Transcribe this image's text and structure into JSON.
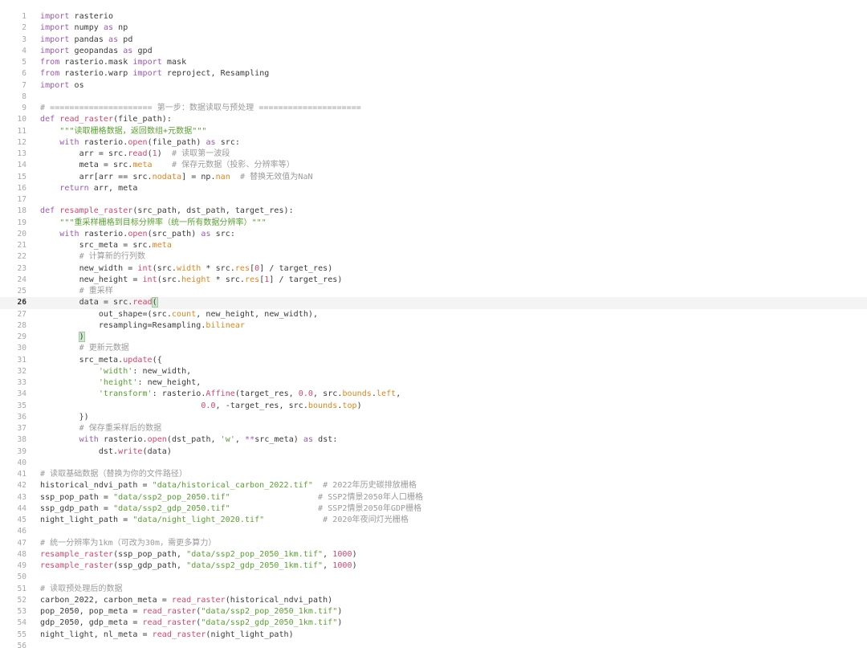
{
  "colors": {
    "keyword": "#9b58b5",
    "function": "#d2466e",
    "string": "#58a130",
    "comment": "#9a9a9a",
    "number": "#d2466e",
    "attribute": "#e0841a",
    "line_number": "#a6a6a6",
    "active_line_bg": "#f4f4f4"
  },
  "editor": {
    "active_line": 26,
    "lines": [
      {
        "n": "1",
        "t": [
          [
            "import",
            "kw"
          ],
          [
            " rasterio",
            ""
          ]
        ]
      },
      {
        "n": "2",
        "t": [
          [
            "import",
            "kw"
          ],
          [
            " numpy ",
            ""
          ],
          [
            "as",
            "kw"
          ],
          [
            " np",
            ""
          ]
        ]
      },
      {
        "n": "3",
        "t": [
          [
            "import",
            "kw"
          ],
          [
            " pandas ",
            ""
          ],
          [
            "as",
            "kw"
          ],
          [
            " pd",
            ""
          ]
        ]
      },
      {
        "n": "4",
        "t": [
          [
            "import",
            "kw"
          ],
          [
            " geopandas ",
            ""
          ],
          [
            "as",
            "kw"
          ],
          [
            " gpd",
            ""
          ]
        ]
      },
      {
        "n": "5",
        "t": [
          [
            "from",
            "kw"
          ],
          [
            " rasterio.mask ",
            ""
          ],
          [
            "import",
            "kw"
          ],
          [
            " mask",
            ""
          ]
        ]
      },
      {
        "n": "6",
        "t": [
          [
            "from",
            "kw"
          ],
          [
            " rasterio.warp ",
            ""
          ],
          [
            "import",
            "kw"
          ],
          [
            " reproject, Resampling",
            ""
          ]
        ]
      },
      {
        "n": "7",
        "t": [
          [
            "import",
            "kw"
          ],
          [
            " os",
            ""
          ]
        ]
      },
      {
        "n": "8",
        "t": []
      },
      {
        "n": "9",
        "t": [
          [
            "# ===================== 第一步：数据读取与预处理 =====================",
            "com"
          ]
        ]
      },
      {
        "n": "10",
        "t": [
          [
            "def",
            "kw"
          ],
          [
            " ",
            ""
          ],
          [
            "read_raster",
            "fn"
          ],
          [
            "(file_path):",
            ""
          ]
        ]
      },
      {
        "n": "11",
        "t": [
          [
            "    ",
            ""
          ],
          [
            "\"\"\"读取栅格数据，返回数组+元数据\"\"\"",
            "str"
          ]
        ]
      },
      {
        "n": "12",
        "t": [
          [
            "    ",
            ""
          ],
          [
            "with",
            "kw"
          ],
          [
            " rasterio.",
            ""
          ],
          [
            "open",
            "fn"
          ],
          [
            "(file_path) ",
            ""
          ],
          [
            "as",
            "kw"
          ],
          [
            " src:",
            ""
          ]
        ]
      },
      {
        "n": "13",
        "t": [
          [
            "        arr = src.",
            ""
          ],
          [
            "read",
            "fn"
          ],
          [
            "(",
            ""
          ],
          [
            "1",
            "num"
          ],
          [
            ")  ",
            ""
          ],
          [
            "# 读取第一波段",
            "com"
          ]
        ]
      },
      {
        "n": "14",
        "t": [
          [
            "        meta = src.",
            ""
          ],
          [
            "meta",
            "attr"
          ],
          [
            "    ",
            ""
          ],
          [
            "# 保存元数据（投影、分辨率等）",
            "com"
          ]
        ]
      },
      {
        "n": "15",
        "t": [
          [
            "        arr[arr == src.",
            ""
          ],
          [
            "nodata",
            "attr"
          ],
          [
            "] = np.",
            ""
          ],
          [
            "nan",
            "attr"
          ],
          [
            "  ",
            ""
          ],
          [
            "# 替换无效值为NaN",
            "com"
          ]
        ]
      },
      {
        "n": "16",
        "t": [
          [
            "    ",
            ""
          ],
          [
            "return",
            "kw"
          ],
          [
            " arr, meta",
            ""
          ]
        ]
      },
      {
        "n": "17",
        "t": []
      },
      {
        "n": "18",
        "t": [
          [
            "def",
            "kw"
          ],
          [
            " ",
            ""
          ],
          [
            "resample_raster",
            "fn"
          ],
          [
            "(src_path, dst_path, target_res):",
            ""
          ]
        ]
      },
      {
        "n": "19",
        "t": [
          [
            "    ",
            ""
          ],
          [
            "\"\"\"重采样栅格到目标分辨率（统一所有数据分辨率）\"\"\"",
            "str"
          ]
        ]
      },
      {
        "n": "20",
        "t": [
          [
            "    ",
            ""
          ],
          [
            "with",
            "kw"
          ],
          [
            " rasterio.",
            ""
          ],
          [
            "open",
            "fn"
          ],
          [
            "(src_path) ",
            ""
          ],
          [
            "as",
            "kw"
          ],
          [
            " src:",
            ""
          ]
        ]
      },
      {
        "n": "21",
        "t": [
          [
            "        src_meta = src.",
            ""
          ],
          [
            "meta",
            "attr"
          ]
        ]
      },
      {
        "n": "22",
        "t": [
          [
            "        ",
            ""
          ],
          [
            "# 计算新的行列数",
            "com"
          ]
        ]
      },
      {
        "n": "23",
        "t": [
          [
            "        new_width = ",
            ""
          ],
          [
            "int",
            "fn"
          ],
          [
            "(src.",
            ""
          ],
          [
            "width",
            "attr"
          ],
          [
            " * src.",
            ""
          ],
          [
            "res",
            "attr"
          ],
          [
            "[",
            ""
          ],
          [
            "0",
            "num"
          ],
          [
            "] / target_res)",
            ""
          ]
        ]
      },
      {
        "n": "24",
        "t": [
          [
            "        new_height = ",
            ""
          ],
          [
            "int",
            "fn"
          ],
          [
            "(src.",
            ""
          ],
          [
            "height",
            "attr"
          ],
          [
            " * src.",
            ""
          ],
          [
            "res",
            "attr"
          ],
          [
            "[",
            ""
          ],
          [
            "1",
            "num"
          ],
          [
            "] / target_res)",
            ""
          ]
        ]
      },
      {
        "n": "25",
        "t": [
          [
            "        ",
            ""
          ],
          [
            "# 重采样",
            "com"
          ]
        ]
      },
      {
        "n": "26",
        "t": [
          [
            "        data = src.",
            ""
          ],
          [
            "read",
            "fn"
          ],
          [
            "(",
            "brk"
          ]
        ]
      },
      {
        "n": "27",
        "t": [
          [
            "            out_shape=(src.",
            ""
          ],
          [
            "count",
            "attr"
          ],
          [
            ", new_height, new_width),",
            ""
          ]
        ]
      },
      {
        "n": "28",
        "t": [
          [
            "            resampling=Resampling.",
            ""
          ],
          [
            "bilinear",
            "attr"
          ]
        ]
      },
      {
        "n": "29",
        "t": [
          [
            "        ",
            ""
          ],
          [
            ")",
            "brk"
          ]
        ]
      },
      {
        "n": "30",
        "t": [
          [
            "        ",
            ""
          ],
          [
            "# 更新元数据",
            "com"
          ]
        ]
      },
      {
        "n": "31",
        "t": [
          [
            "        src_meta.",
            ""
          ],
          [
            "update",
            "fn"
          ],
          [
            "({",
            ""
          ]
        ]
      },
      {
        "n": "32",
        "t": [
          [
            "            ",
            ""
          ],
          [
            "'width'",
            "str"
          ],
          [
            ": new_width,",
            ""
          ]
        ]
      },
      {
        "n": "33",
        "t": [
          [
            "            ",
            ""
          ],
          [
            "'height'",
            "str"
          ],
          [
            ": new_height,",
            ""
          ]
        ]
      },
      {
        "n": "34",
        "t": [
          [
            "            ",
            ""
          ],
          [
            "'transform'",
            "str"
          ],
          [
            ": rasterio.",
            ""
          ],
          [
            "Affine",
            "fn"
          ],
          [
            "(target_res, ",
            ""
          ],
          [
            "0.0",
            "num"
          ],
          [
            ", src.",
            ""
          ],
          [
            "bounds",
            "attr"
          ],
          [
            ".",
            ""
          ],
          [
            "left",
            "attr"
          ],
          [
            ",",
            ""
          ]
        ]
      },
      {
        "n": "35",
        "t": [
          [
            "                                 ",
            ""
          ],
          [
            "0.0",
            "num"
          ],
          [
            ", -target_res, src.",
            ""
          ],
          [
            "bounds",
            "attr"
          ],
          [
            ".",
            ""
          ],
          [
            "top",
            "attr"
          ],
          [
            ")",
            ""
          ]
        ]
      },
      {
        "n": "36",
        "t": [
          [
            "        })",
            ""
          ]
        ]
      },
      {
        "n": "37",
        "t": [
          [
            "        ",
            ""
          ],
          [
            "# 保存重采样后的数据",
            "com"
          ]
        ]
      },
      {
        "n": "38",
        "t": [
          [
            "        ",
            ""
          ],
          [
            "with",
            "kw"
          ],
          [
            " rasterio.",
            ""
          ],
          [
            "open",
            "fn"
          ],
          [
            "(dst_path, ",
            ""
          ],
          [
            "'w'",
            "str"
          ],
          [
            ", ",
            ""
          ],
          [
            "**",
            "kw"
          ],
          [
            "src_meta) ",
            ""
          ],
          [
            "as",
            "kw"
          ],
          [
            " dst:",
            ""
          ]
        ]
      },
      {
        "n": "39",
        "t": [
          [
            "            dst.",
            ""
          ],
          [
            "write",
            "fn"
          ],
          [
            "(data)",
            ""
          ]
        ]
      },
      {
        "n": "40",
        "t": []
      },
      {
        "n": "41",
        "t": [
          [
            "# 读取基础数据（替换为你的文件路径）",
            "com"
          ]
        ]
      },
      {
        "n": "42",
        "t": [
          [
            "historical_ndvi_path = ",
            ""
          ],
          [
            "\"data/historical_carbon_2022.tif\"",
            "str"
          ],
          [
            "  ",
            ""
          ],
          [
            "# 2022年历史碳排放栅格",
            "com"
          ]
        ]
      },
      {
        "n": "43",
        "t": [
          [
            "ssp_pop_path = ",
            ""
          ],
          [
            "\"data/ssp2_pop_2050.tif\"",
            "str"
          ],
          [
            "                  ",
            ""
          ],
          [
            "# SSP2情景2050年人口栅格",
            "com"
          ]
        ]
      },
      {
        "n": "44",
        "t": [
          [
            "ssp_gdp_path = ",
            ""
          ],
          [
            "\"data/ssp2_gdp_2050.tif\"",
            "str"
          ],
          [
            "                  ",
            ""
          ],
          [
            "# SSP2情景2050年GDP栅格",
            "com"
          ]
        ]
      },
      {
        "n": "45",
        "t": [
          [
            "night_light_path = ",
            ""
          ],
          [
            "\"data/night_light_2020.tif\"",
            "str"
          ],
          [
            "            ",
            ""
          ],
          [
            "# 2020年夜间灯光栅格",
            "com"
          ]
        ]
      },
      {
        "n": "46",
        "t": []
      },
      {
        "n": "47",
        "t": [
          [
            "# 统一分辨率为1km（可改为30m，需更多算力）",
            "com"
          ]
        ]
      },
      {
        "n": "48",
        "t": [
          [
            "resample_raster",
            "fn"
          ],
          [
            "(ssp_pop_path, ",
            ""
          ],
          [
            "\"data/ssp2_pop_2050_1km.tif\"",
            "str"
          ],
          [
            ", ",
            ""
          ],
          [
            "1000",
            "num"
          ],
          [
            ")",
            ""
          ]
        ]
      },
      {
        "n": "49",
        "t": [
          [
            "resample_raster",
            "fn"
          ],
          [
            "(ssp_gdp_path, ",
            ""
          ],
          [
            "\"data/ssp2_gdp_2050_1km.tif\"",
            "str"
          ],
          [
            ", ",
            ""
          ],
          [
            "1000",
            "num"
          ],
          [
            ")",
            ""
          ]
        ]
      },
      {
        "n": "50",
        "t": []
      },
      {
        "n": "51",
        "t": [
          [
            "# 读取预处理后的数据",
            "com"
          ]
        ]
      },
      {
        "n": "52",
        "t": [
          [
            "carbon_2022, carbon_meta = ",
            ""
          ],
          [
            "read_raster",
            "fn"
          ],
          [
            "(historical_ndvi_path)",
            ""
          ]
        ]
      },
      {
        "n": "53",
        "t": [
          [
            "pop_2050, pop_meta = ",
            ""
          ],
          [
            "read_raster",
            "fn"
          ],
          [
            "(",
            ""
          ],
          [
            "\"data/ssp2_pop_2050_1km.tif\"",
            "str"
          ],
          [
            ")",
            ""
          ]
        ]
      },
      {
        "n": "54",
        "t": [
          [
            "gdp_2050, gdp_meta = ",
            ""
          ],
          [
            "read_raster",
            "fn"
          ],
          [
            "(",
            ""
          ],
          [
            "\"data/ssp2_gdp_2050_1km.tif\"",
            "str"
          ],
          [
            ")",
            ""
          ]
        ]
      },
      {
        "n": "55",
        "t": [
          [
            "night_light, nl_meta = ",
            ""
          ],
          [
            "read_raster",
            "fn"
          ],
          [
            "(night_light_path)",
            ""
          ]
        ]
      },
      {
        "n": "56",
        "t": []
      }
    ]
  }
}
